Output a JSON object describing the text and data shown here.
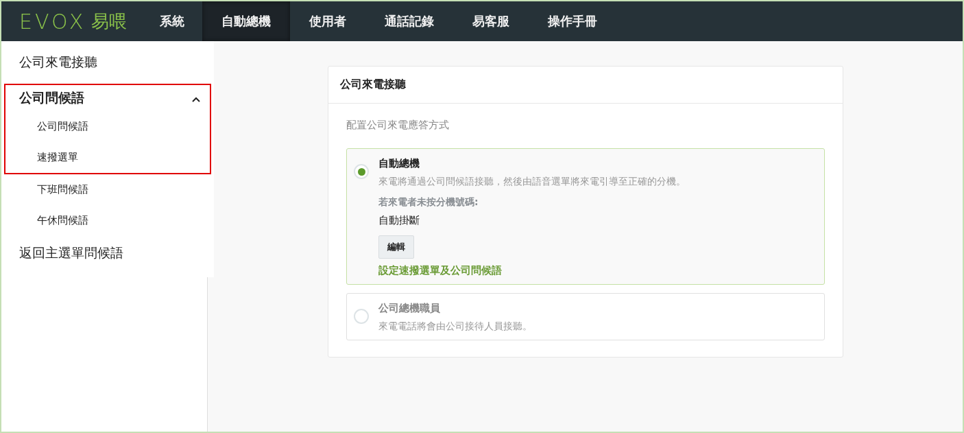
{
  "logo": {
    "mark": "EVOX",
    "name": "易喂"
  },
  "nav": [
    {
      "label": "系統",
      "selected": false
    },
    {
      "label": "自動總機",
      "selected": true
    },
    {
      "label": "使用者",
      "selected": false
    },
    {
      "label": "通話記錄",
      "selected": false
    },
    {
      "label": "易客服",
      "selected": false
    },
    {
      "label": "操作手冊",
      "selected": false
    }
  ],
  "sidebar": {
    "items": [
      {
        "kind": "item",
        "label": "公司來電接聽"
      },
      {
        "kind": "group",
        "label": "公司問候語",
        "expanded": true,
        "highlighted": true,
        "children": [
          {
            "label": "公司問候語"
          },
          {
            "label": "速撥選單"
          }
        ]
      },
      {
        "kind": "subitem",
        "label": "下班問候語"
      },
      {
        "kind": "subitem",
        "label": "午休問候語"
      },
      {
        "kind": "item",
        "label": "返回主選單問候語"
      }
    ]
  },
  "panel": {
    "title": "公司來電接聽",
    "subtitle": "配置公司來電應答方式",
    "options": [
      {
        "title": "自動總機",
        "selected": true,
        "description": "來電將通過公司問候語接聽，然後由語音選單將來電引導至正確的分機。",
        "fallback_label": "若來電者未按分機號碼:",
        "fallback_value": "自動掛斷",
        "edit_button": "編輯",
        "link": "設定速撥選單及公司問候語"
      },
      {
        "title": "公司總機職員",
        "selected": false,
        "description": "來電電話將會由公司接待人員接聽。"
      }
    ]
  }
}
